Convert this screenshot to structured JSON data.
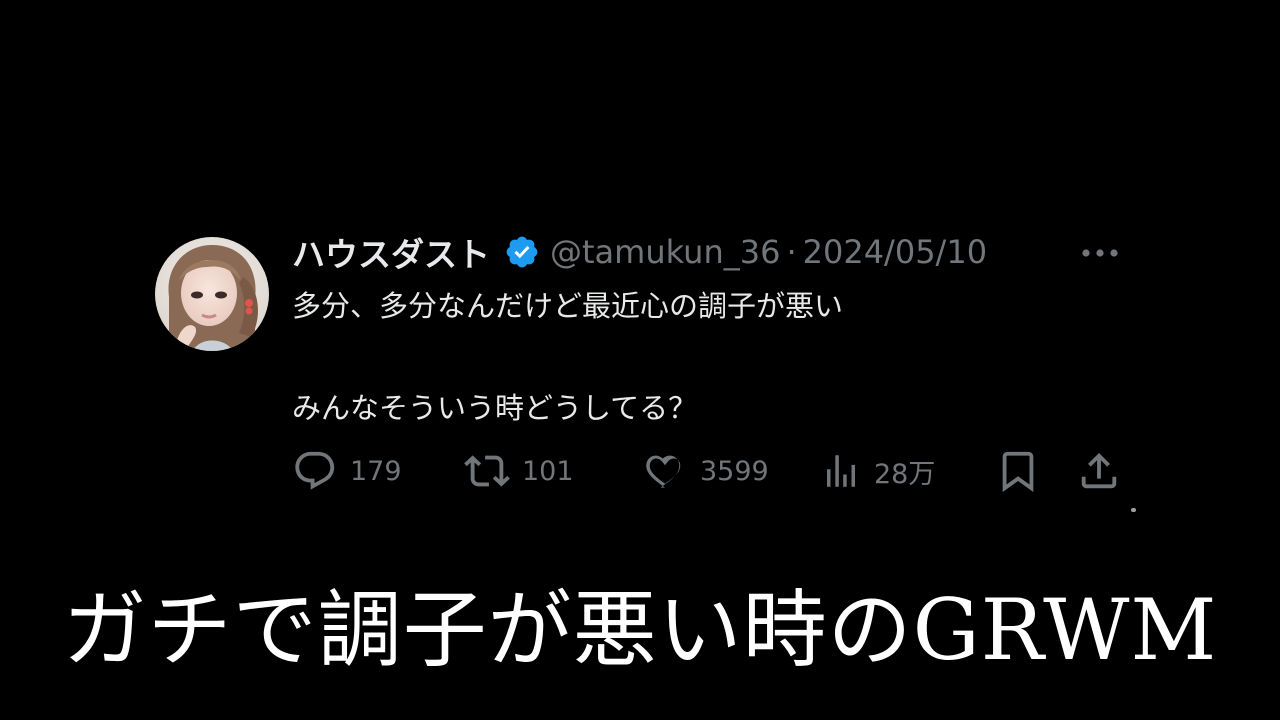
{
  "tweet": {
    "display_name": "ハウスダスト",
    "handle": "@tamukun_36",
    "separator": "·",
    "date": "2024/05/10",
    "text_line1": "多分、多分なんだけど最近心の調子が悪い",
    "text_line2": "みんなそういう時どうしてる？",
    "verified_color": "#1d9bf0",
    "icons": [
      "verified-icon",
      "more-icon",
      "reply-icon",
      "retweet-icon",
      "like-icon",
      "views-icon",
      "bookmark-icon",
      "share-icon"
    ]
  },
  "actions": {
    "replies": "179",
    "retweets": "101",
    "likes": "3599",
    "views": "28万"
  },
  "caption": {
    "text": "ガチで調子が悪い時のGRWM"
  },
  "colors": {
    "background": "#000000",
    "primary_text": "#e7e9ea",
    "secondary_text": "#71767b",
    "caption_text": "#ffffff"
  }
}
